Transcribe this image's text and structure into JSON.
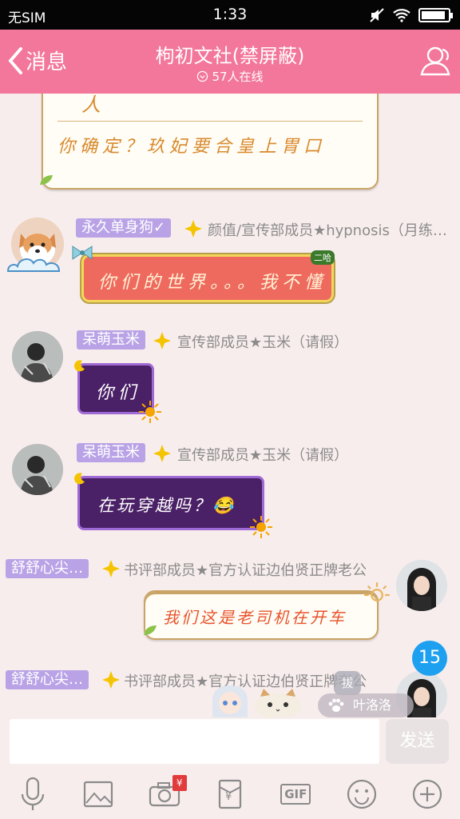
{
  "status_bar": {
    "carrier": "无SIM",
    "time": "1:33",
    "battery_level": 0.9
  },
  "header": {
    "back_label": "消息",
    "title": "枸初文社(禁屏蔽)",
    "online": "57人在线"
  },
  "messages": [
    {
      "text": "你确定？玖妃要合皇上胃口",
      "partial_top": "人"
    },
    {
      "name": "永久单身狗✓",
      "role": "颜值/宣传部成员★hypnosis（月练…",
      "tag": "二哈",
      "text": "你们的世界。。。我不懂"
    },
    {
      "name": "呆萌玉米",
      "role": "宣传部成员★玉米（请假）",
      "text": "你们"
    },
    {
      "name": "呆萌玉米",
      "role": "宣传部成员★玉米（请假）",
      "text": "在玩穿越吗？😂"
    },
    {
      "name": "舒舒心尖…",
      "role": "书评部成员★官方认证边伯贤正牌老公",
      "text": "我们这是老司机在开车"
    },
    {
      "name": "舒舒心尖…",
      "role": "书评部成员★官方认证边伯贤正牌老公"
    }
  ],
  "overlay": {
    "unread_count": "15",
    "typing_name": "叶洛洛",
    "typing_badge": "拔"
  },
  "input": {
    "placeholder": "",
    "send_label": "发送"
  },
  "toolbar": {
    "gif_label": "GIF",
    "red_packet_mark": "¥",
    "wallet_mark": "¥"
  },
  "colors": {
    "header": "#f3769b",
    "name_tag": "#b9a3e6",
    "unread_badge": "#1ea0f0"
  }
}
